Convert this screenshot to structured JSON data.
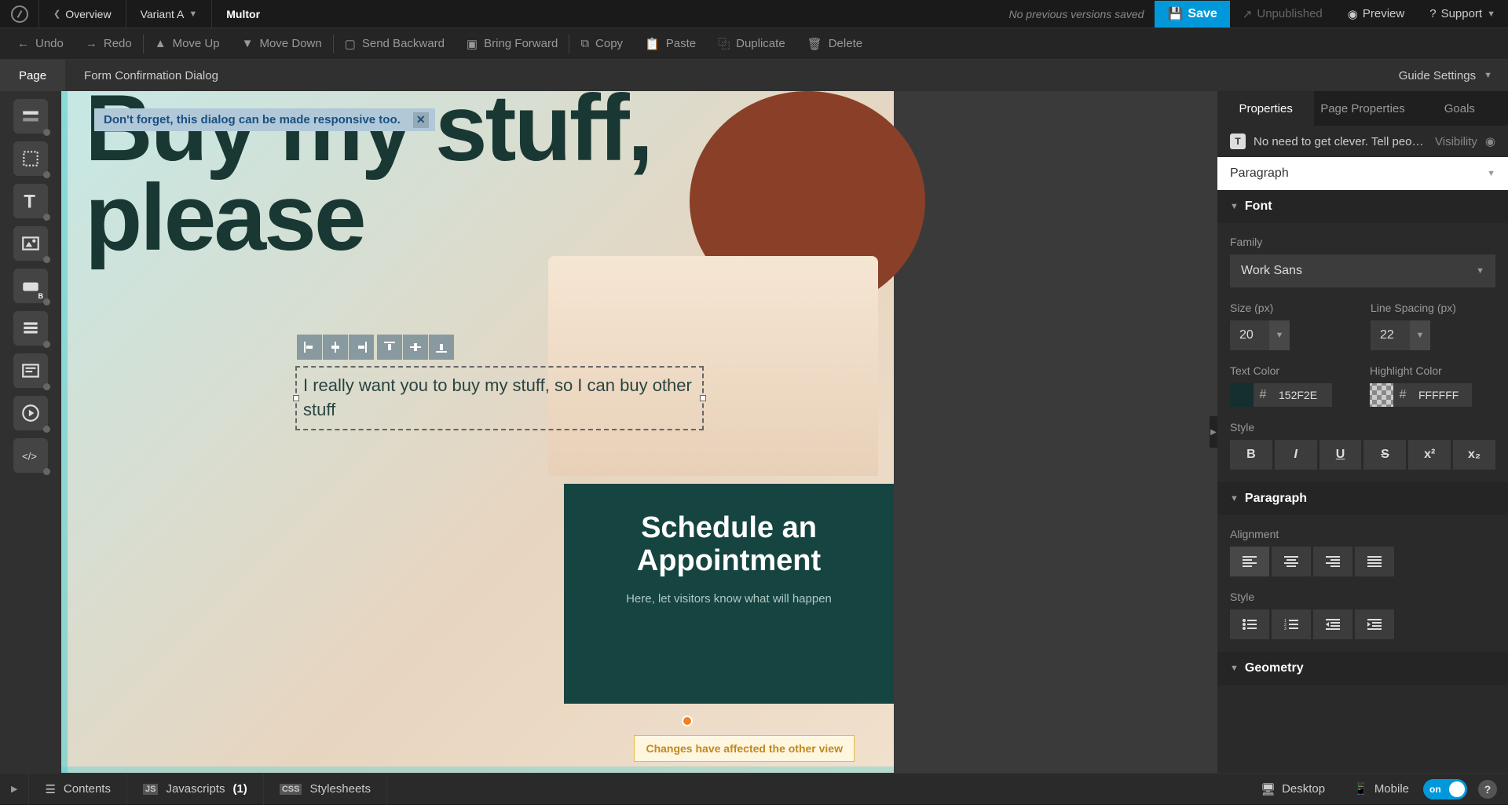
{
  "topbar": {
    "overview": "Overview",
    "variant": "Variant A",
    "title": "Multor",
    "status": "No previous versions saved",
    "save": "Save",
    "unpublished": "Unpublished",
    "preview": "Preview",
    "support": "Support"
  },
  "actionbar": {
    "undo": "Undo",
    "redo": "Redo",
    "moveup": "Move Up",
    "movedown": "Move Down",
    "sendback": "Send Backward",
    "bringforward": "Bring Forward",
    "copy": "Copy",
    "paste": "Paste",
    "duplicate": "Duplicate",
    "delete": "Delete"
  },
  "subnav": {
    "page": "Page",
    "dialog": "Form Confirmation Dialog",
    "guide": "Guide Settings"
  },
  "canvas": {
    "tooltip": "Don't forget, this dialog can be made responsive too.",
    "headline": "Buy my stuff, please",
    "selected_text": "I really want you to buy my stuff, so I can buy other stuff",
    "panel_title": "Schedule an Appointment",
    "panel_sub": "Here, let visitors know what will happen",
    "changes_notice": "Changes have affected the other view"
  },
  "props": {
    "tabs": {
      "properties": "Properties",
      "page_properties": "Page Properties",
      "goals": "Goals"
    },
    "header_text": "No need to get clever. Tell peopl…",
    "visibility": "Visibility",
    "element_type": "Paragraph",
    "font": {
      "section": "Font",
      "family_label": "Family",
      "family_value": "Work Sans",
      "size_label": "Size (px)",
      "size_value": "20",
      "line_label": "Line Spacing (px)",
      "line_value": "22",
      "textcolor_label": "Text Color",
      "textcolor_value": "152F2E",
      "highlight_label": "Highlight Color",
      "highlight_value": "FFFFFF",
      "style_label": "Style",
      "bold": "B",
      "italic": "I",
      "underline": "U",
      "strike": "S",
      "sup": "x²",
      "sub": "x₂"
    },
    "paragraph": {
      "section": "Paragraph",
      "alignment_label": "Alignment",
      "style_label": "Style"
    },
    "geometry": {
      "section": "Geometry"
    }
  },
  "bottombar": {
    "contents": "Contents",
    "javascripts": "Javascripts",
    "js_count": "(1)",
    "stylesheets": "Stylesheets",
    "desktop": "Desktop",
    "mobile": "Mobile",
    "toggle": "on",
    "help": "?"
  }
}
